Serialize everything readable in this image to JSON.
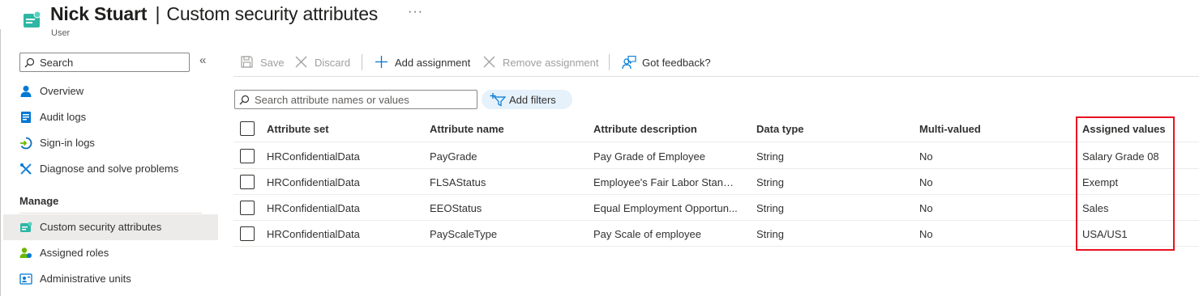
{
  "header": {
    "name": "Nick Stuart",
    "separator": "|",
    "title": "Custom security attributes",
    "more": "···",
    "subtitle": "User"
  },
  "nav": {
    "search_placeholder": "Search",
    "collapse_glyph": "«",
    "items": [
      {
        "label": "Overview",
        "icon": "user-icon"
      },
      {
        "label": "Audit logs",
        "icon": "audit-log-icon"
      },
      {
        "label": "Sign-in logs",
        "icon": "sign-in-icon"
      },
      {
        "label": "Diagnose and solve problems",
        "icon": "wrench-icon"
      }
    ],
    "section": "Manage",
    "manage_items": [
      {
        "label": "Custom security attributes",
        "icon": "custom-attributes-icon",
        "active": true
      },
      {
        "label": "Assigned roles",
        "icon": "assigned-roles-icon"
      },
      {
        "label": "Administrative units",
        "icon": "admin-units-icon"
      }
    ]
  },
  "toolbar": {
    "save": "Save",
    "discard": "Discard",
    "add_assignment": "Add assignment",
    "remove_assignment": "Remove assignment",
    "feedback": "Got feedback?"
  },
  "filters": {
    "search_placeholder": "Search attribute names or values",
    "add_filters": "Add filters"
  },
  "table": {
    "columns": [
      "Attribute set",
      "Attribute name",
      "Attribute description",
      "Data type",
      "Multi-valued",
      "Assigned values"
    ],
    "rows": [
      [
        "HRConfidentialData",
        "PayGrade",
        "Pay Grade of Employee",
        "String",
        "No",
        "Salary Grade 08"
      ],
      [
        "HRConfidentialData",
        "FLSAStatus",
        "Employee's Fair Labor Standa...",
        "String",
        "No",
        "Exempt"
      ],
      [
        "HRConfidentialData",
        "EEOStatus",
        "Equal Employment Opportun...",
        "String",
        "No",
        "Sales"
      ],
      [
        "HRConfidentialData",
        "PayScaleType",
        "Pay Scale of employee",
        "String",
        "No",
        "USA/US1"
      ]
    ]
  },
  "colors": {
    "accent": "#0078d4",
    "highlight": "#e81123",
    "active_nav": "#edebe9",
    "teal_icon": "#2db7a4"
  }
}
